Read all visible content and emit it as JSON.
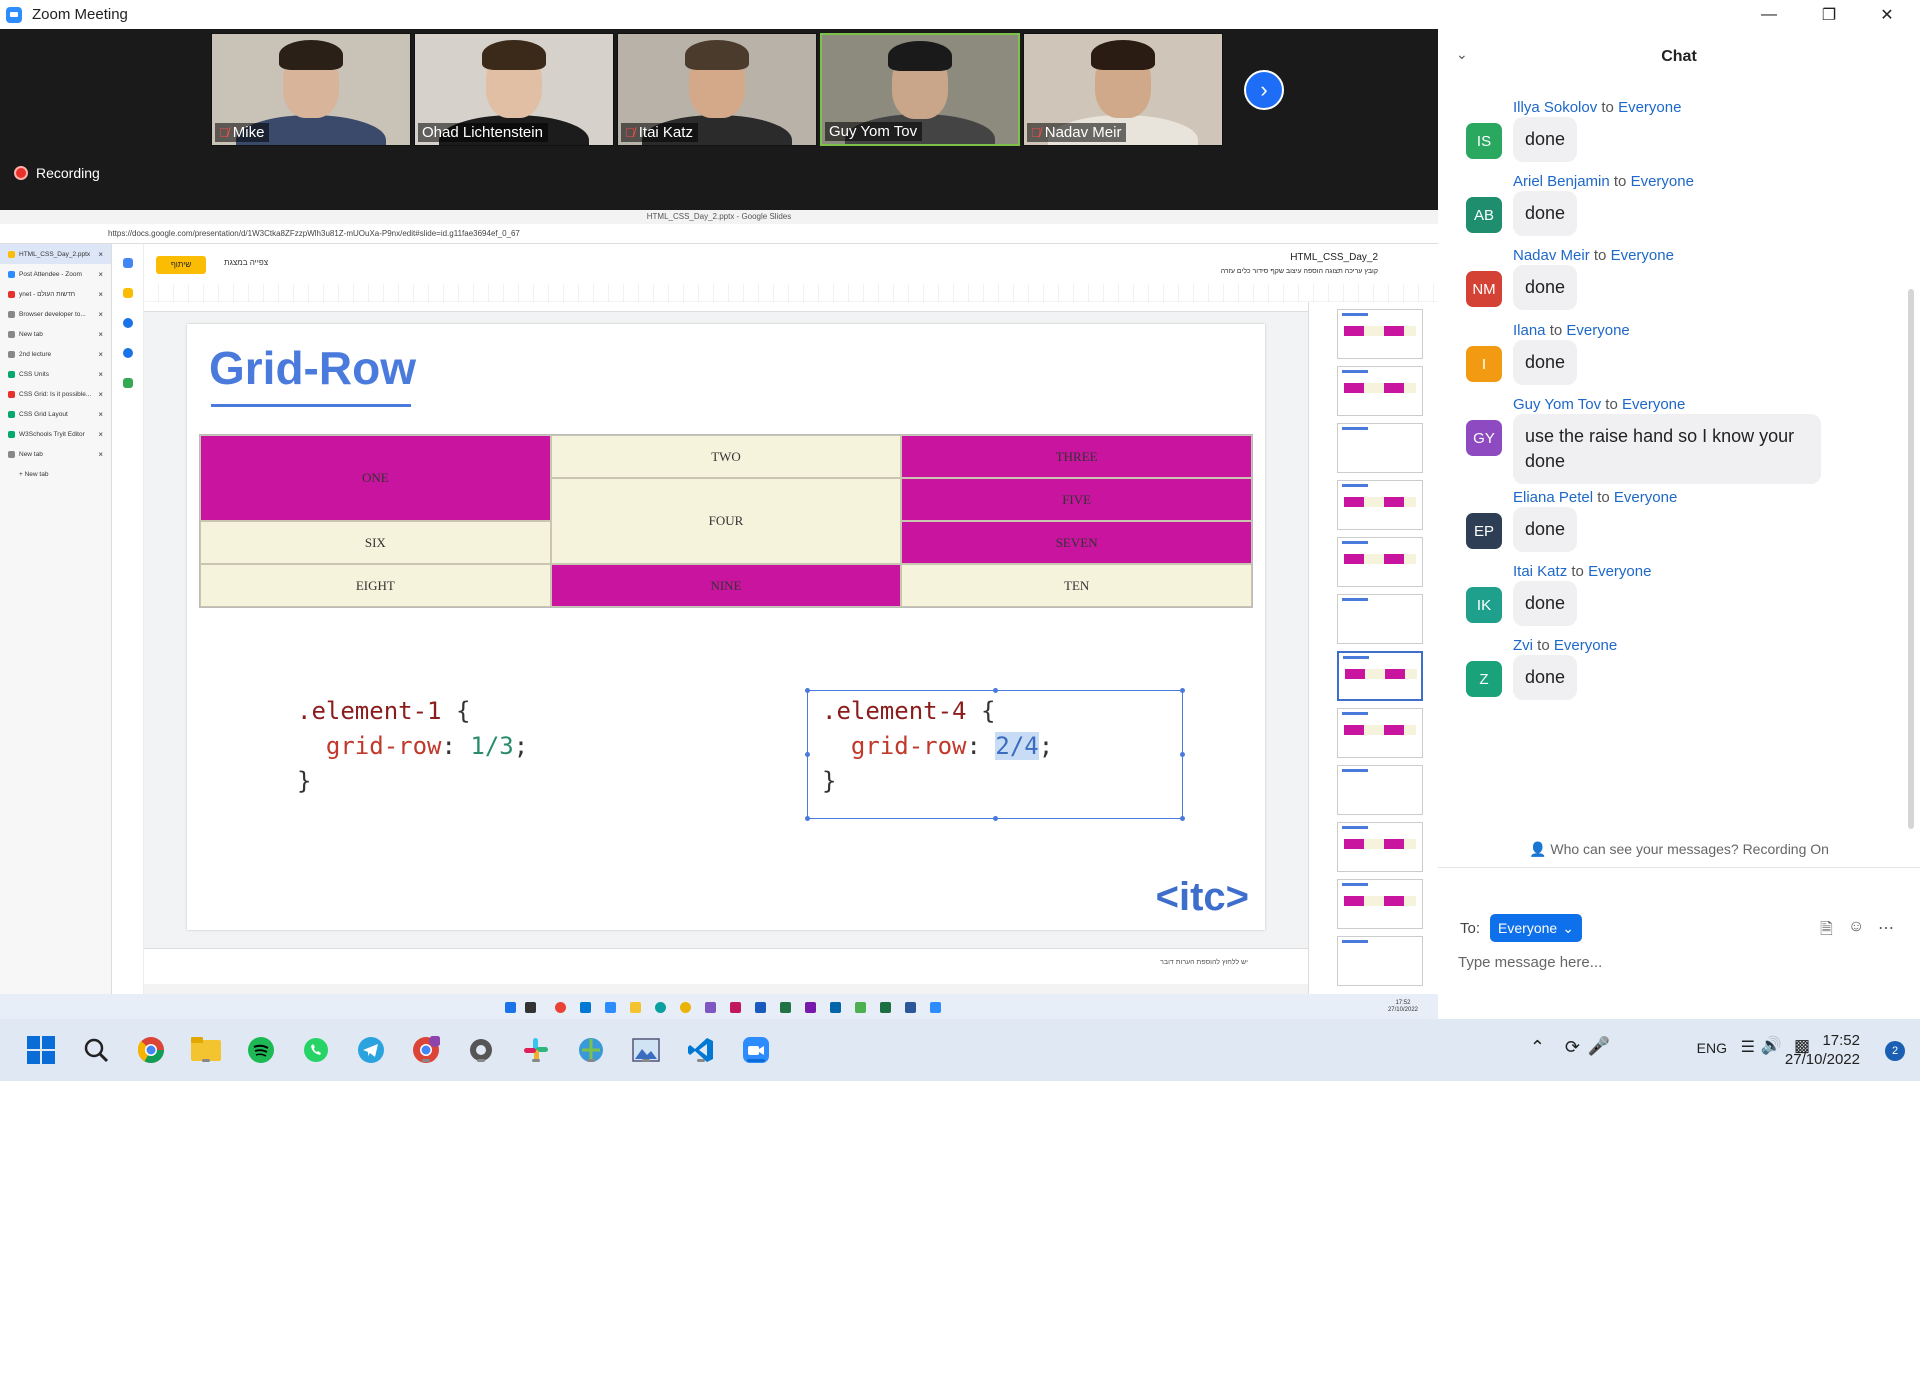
{
  "window": {
    "title": "Zoom Meeting"
  },
  "participants": [
    {
      "name": "Mike",
      "muted": true,
      "skin": "#d8b49a",
      "hair": "#2a2018",
      "shirt": "#3b4a6b",
      "bg": "#c9c2b7"
    },
    {
      "name": "Ohad Lichtenstein",
      "muted": false,
      "skin": "#e0bfa5",
      "hair": "#3b2a1a",
      "shirt": "#1c1c1c",
      "bg": "#d6d2cb"
    },
    {
      "name": "Itai Katz",
      "muted": true,
      "skin": "#d3a98a",
      "hair": "#4b3b2c",
      "shirt": "#2b2b2b",
      "bg": "#b9b2a8"
    },
    {
      "name": "Guy Yom Tov",
      "muted": false,
      "skin": "#c9a58a",
      "hair": "#1a1a1a",
      "shirt": "#444",
      "bg": "#8d8a7e"
    },
    {
      "name": "Nadav Meir",
      "muted": true,
      "skin": "#d0a98b",
      "hair": "#2a1c12",
      "shirt": "#e8e4dc",
      "bg": "#cfc6b9"
    }
  ],
  "recording": {
    "label": "Recording"
  },
  "browser": {
    "title": "HTML_CSS_Day_2.pptx - Google Slides",
    "url": "https://docs.google.com/presentation/d/1W3Ctka8ZFzzpWlh3u81Z-mUOuXa-P9nx/edit#slide=id.g11fae3694ef_0_67",
    "tabs": [
      {
        "label": "HTML_CSS_Day_2.pptx",
        "color": "#fbbc04",
        "active": true
      },
      {
        "label": "Post Attendee - Zoom",
        "color": "#2d8cff",
        "active": false
      },
      {
        "label": "ynet - חדשות העולם",
        "color": "#e8312b",
        "active": false
      },
      {
        "label": "Browser developer to...",
        "color": "#888",
        "active": false
      },
      {
        "label": "New tab",
        "color": "#888",
        "active": false
      },
      {
        "label": "2nd lecture",
        "color": "#888",
        "active": false
      },
      {
        "label": "CSS Units",
        "color": "#04aa6d",
        "active": false
      },
      {
        "label": "CSS Grid: Is it possible...",
        "color": "#e8312b",
        "active": false
      },
      {
        "label": "CSS Grid Layout",
        "color": "#04aa6d",
        "active": false
      },
      {
        "label": "W3Schools Tryit Editor",
        "color": "#04aa6d",
        "active": false
      },
      {
        "label": "New tab",
        "color": "#888",
        "active": false
      },
      {
        "label": "+ New tab",
        "color": "transparent",
        "active": false
      }
    ]
  },
  "slides_app": {
    "share_label": "שיתוף",
    "present_label": "צפייה במצגת",
    "doc_name": "HTML_CSS_Day_2",
    "menus": "קובץ  עריכה  תצוגה  הוספה  עיצוב  שקף  סידור  כלים  עזרה",
    "notes_placeholder": "יש ללחוץ להוספת הערות דובר"
  },
  "slide": {
    "title": "Grid-Row",
    "cells": [
      "ONE",
      "TWO",
      "THREE",
      "FOUR",
      "FIVE",
      "SIX",
      "SEVEN",
      "EIGHT",
      "NINE",
      "TEN"
    ],
    "code1": {
      "selector": ".element-1",
      "prop": "grid-row",
      "value": "1/3"
    },
    "code2": {
      "selector": ".element-4",
      "prop": "grid-row",
      "value": "2/4"
    },
    "logo": "<itc>"
  },
  "chat": {
    "title": "Chat",
    "messages": [
      {
        "sender": "Illya Sokolov",
        "to": "Everyone",
        "initials": "IS",
        "color": "#2aa860",
        "text": "done"
      },
      {
        "sender": "Ariel Benjamin",
        "to": "Everyone",
        "initials": "AB",
        "color": "#1e8e6e",
        "text": "done"
      },
      {
        "sender": "Nadav Meir",
        "to": "Everyone",
        "initials": "NM",
        "color": "#d44235",
        "text": "done"
      },
      {
        "sender": "Ilana",
        "to": "Everyone",
        "initials": "I",
        "color": "#f29b12",
        "text": "done"
      },
      {
        "sender": "Guy Yom Tov",
        "to": "Everyone",
        "initials": "GY",
        "color": "#8e4ac0",
        "text": "use the raise hand so I know your done"
      },
      {
        "sender": "Eliana Petel",
        "to": "Everyone",
        "initials": "EP",
        "color": "#2e3f55",
        "text": "done"
      },
      {
        "sender": "Itai Katz",
        "to": "Everyone",
        "initials": "IK",
        "color": "#1fa08c",
        "text": "done"
      },
      {
        "sender": "Zvi",
        "to": "Everyone",
        "initials": "Z",
        "color": "#1aa37a",
        "text": "done"
      }
    ],
    "to_word": "to",
    "visibility": "Who can see your messages? Recording On",
    "to_label": "To:",
    "recipient": "Everyone",
    "input_placeholder": "Type message here..."
  },
  "taskbar": {
    "lang": "ENG",
    "time": "17:52",
    "date": "27/10/2022",
    "notifications": "2",
    "inner_time": "17:52",
    "inner_date": "27/10/2022"
  }
}
